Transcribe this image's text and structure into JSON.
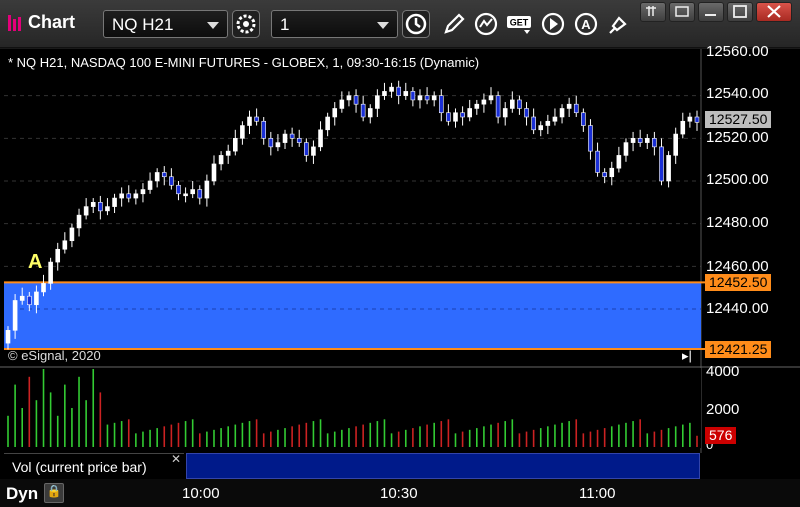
{
  "window": {
    "title": "Chart",
    "symbol_value": "NQ H21",
    "interval_value": "1"
  },
  "toolbar_icons": [
    "settings-icon",
    "time-icon",
    "draw-pencil-icon",
    "studies-icon",
    "get-icon",
    "play-icon",
    "alert-icon",
    "pin-icon"
  ],
  "chart": {
    "header": "* NQ H21, NASDAQ 100 E-MINI FUTURES - GLOBEX, 1, 09:30-16:15 (Dynamic)",
    "copyright": "© eSignal, 2020",
    "marker_label": "A",
    "price_axis": [
      "12560.00",
      "12540.00",
      "12520.00",
      "12500.00",
      "12480.00",
      "12460.00",
      "12440.00"
    ],
    "current_price": "12527.50",
    "band_upper": "12452.50",
    "band_lower": "12421.25",
    "volume_axis": [
      "4000",
      "2000",
      "0"
    ],
    "current_volume": "576",
    "volume_label": "Vol (current price bar)",
    "dynamic_label": "Dyn",
    "time_axis": [
      "10:00",
      "10:30",
      "11:00"
    ],
    "colors": {
      "band": "#2f6bff",
      "band_edge": "#ff8c1a",
      "up_candle": "#ffffff",
      "down_candle": "#1a2fd6",
      "vol_up": "#33cc33",
      "vol_down": "#cc2222",
      "current_price_box": "#bdbdbd",
      "current_volume_box": "#cc0000",
      "marker": "#ffff66"
    }
  },
  "chart_data": {
    "type": "candlestick",
    "series": [
      {
        "name": "NQ H21",
        "close": [
          12430,
          12444,
          12446,
          12442,
          12448,
          12452,
          12462,
          12468,
          12472,
          12478,
          12484,
          12488,
          12490,
          12486,
          12488,
          12492,
          12494,
          12492,
          12494,
          12496,
          12500,
          12504,
          12502,
          12498,
          12494,
          12494,
          12496,
          12492,
          12500,
          12508,
          12512,
          12514,
          12520,
          12526,
          12530,
          12528,
          12520,
          12516,
          12518,
          12522,
          12520,
          12518,
          12512,
          12516,
          12524,
          12530,
          12534,
          12538,
          12540,
          12536,
          12530,
          12534,
          12540,
          12542,
          12544,
          12540,
          12542,
          12538,
          12540,
          12538,
          12540,
          12532,
          12528,
          12532,
          12530,
          12534,
          12536,
          12538,
          12540,
          12530,
          12534,
          12538,
          12534,
          12530,
          12524,
          12526,
          12528,
          12530,
          12534,
          12536,
          12532,
          12526,
          12514,
          12504,
          12502,
          12506,
          12512,
          12518,
          12520,
          12518,
          12520,
          12516,
          12500,
          12512,
          12522,
          12528,
          12530,
          12527.5
        ]
      }
    ]
  }
}
